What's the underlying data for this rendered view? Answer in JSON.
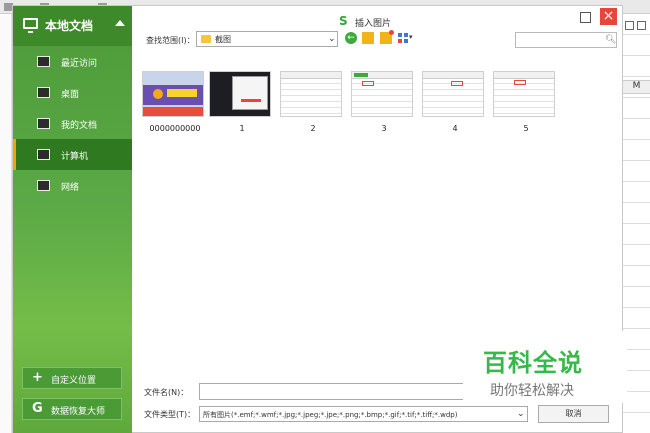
{
  "dialog": {
    "title": "插入图片",
    "close_symbol": "×"
  },
  "sidebar": {
    "header": "本地文档",
    "items": [
      {
        "label": "最近访问",
        "icon": "recent-icon"
      },
      {
        "label": "桌面",
        "icon": "desktop-icon"
      },
      {
        "label": "我的文档",
        "icon": "documents-icon"
      },
      {
        "label": "计算机",
        "icon": "computer-icon",
        "active": true
      },
      {
        "label": "网络",
        "icon": "network-icon"
      }
    ],
    "custom_location": "自定义位置",
    "data_recovery": "数据恢复大师"
  },
  "toolbar": {
    "look_in_label": "查找范围(I)：",
    "look_in_value": "截图"
  },
  "files": [
    {
      "name": "0000000000",
      "thumb": "promo"
    },
    {
      "name": "1",
      "thumb": "dark"
    },
    {
      "name": "2",
      "thumb": "sheet"
    },
    {
      "name": "3",
      "thumb": "sheet"
    },
    {
      "name": "4",
      "thumb": "sheet"
    },
    {
      "name": "5",
      "thumb": "sheet"
    }
  ],
  "footer": {
    "filename_label": "文件名(N)：",
    "filename_value": "",
    "filetype_label": "文件类型(T)：",
    "filetype_value": "所有图片(*.emf;*.wmf;*.jpg;*.jpeg;*.jpe;*.png;*.bmp;*.gif;*.tif;*.tiff;*.wdp)",
    "cancel_label": "取消"
  },
  "watermark": {
    "title": "百科全说",
    "subtitle": "助你轻松解决"
  },
  "background": {
    "column_header": "M"
  },
  "colors": {
    "sidebar_green": "#5aa846",
    "active_indicator": "#f0a400",
    "close_red": "#e9463b",
    "watermark_green": "#36b94a"
  }
}
